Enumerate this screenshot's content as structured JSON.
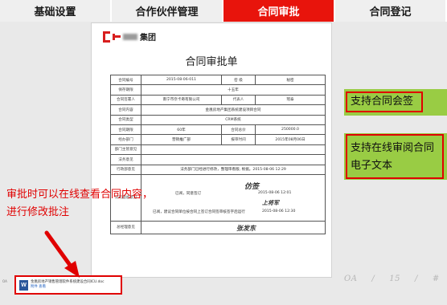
{
  "nav": {
    "tabs": [
      {
        "label": "基础设置",
        "active": false
      },
      {
        "label": "合作伙伴管理",
        "active": false
      },
      {
        "label": "合同审批",
        "active": true
      },
      {
        "label": "合同登记",
        "active": false
      }
    ],
    "active_color": "#e8140c"
  },
  "document": {
    "logo_text": "集团",
    "title": "合同审批单",
    "rows": {
      "r1": [
        "合同编号",
        "2015-08-06-011",
        "密 级",
        "秘密"
      ],
      "r2": [
        "保存期限",
        "十五年"
      ],
      "r3": [
        "合同签署人",
        "南宁市奈卡奇有限公司",
        "代表人",
        "瑶泰"
      ],
      "r4": [
        "合同内容",
        "金凰房地产集团系统建设项目合同"
      ],
      "r5": [
        "合同类型",
        "CRM系统"
      ],
      "r6": [
        "合同期限",
        "60年",
        "合同总价",
        "250000.0"
      ],
      "r7": [
        "经办部门",
        "营销推广部",
        "报审时间",
        "2015年08月06日"
      ],
      "r8": [
        "部门主管意见",
        ""
      ],
      "r9": [
        "法务意见",
        ""
      ],
      "r10": [
        "行政部意见",
        "法务部门已经进行修改，整理审看版, 根据。2015-08-06 12:29"
      ],
      "r11": {
        "label": "公司副总意见",
        "handwriting_1": "仿签",
        "line_1": "已阅，同意签订",
        "time_1": "2015-08-06 12:01",
        "handwriting_2": "上将军",
        "line_2": "已阅，建议合同单位按合同上签订合同签审核签字后运行",
        "time_2": "2015-08-06 12:30"
      },
      "r12": {
        "label": "总经理意见",
        "handwriting": "张发东"
      }
    }
  },
  "attachment": {
    "icon": "word-doc-icon",
    "filename": "金凰房地产销售管理软件系统建设合同ICU.doc",
    "links": "附件  查看"
  },
  "callouts": {
    "c1": "支持合同会签",
    "c2_line1": "支持在线审阅合同",
    "c2_line2": "电子文本"
  },
  "note": {
    "line1": "审批时可以在线查看合同内容，",
    "line2": "进行修改批注"
  },
  "pager": {
    "left": "OA",
    "page": "15",
    "right": "#"
  },
  "footer_tiny": "OA"
}
